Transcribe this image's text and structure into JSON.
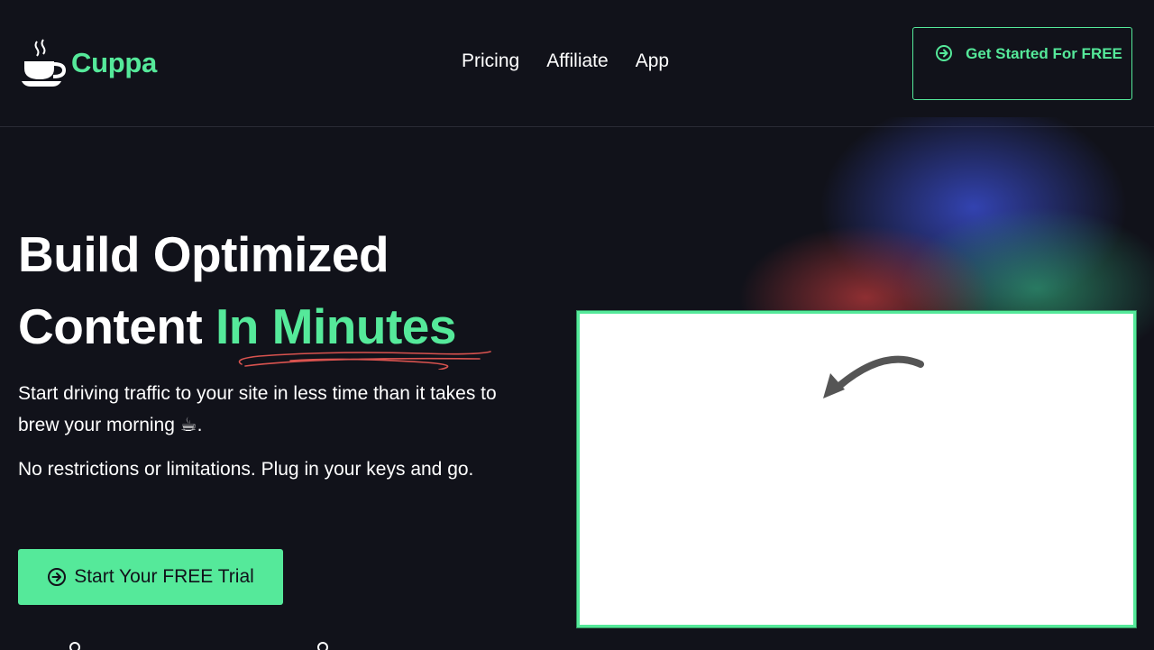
{
  "brand": {
    "name": "Cuppa",
    "accent_color": "#55e99a",
    "background_color": "#11121a",
    "logo_icon": "coffee-cup-icon"
  },
  "nav": {
    "items": [
      {
        "label": "Pricing"
      },
      {
        "label": "Affiliate"
      },
      {
        "label": "App"
      }
    ]
  },
  "header_cta": {
    "label": "Get Started For FREE",
    "icon": "arrow-right-circle-icon"
  },
  "hero": {
    "title_part1": "Build Optimized Content ",
    "title_accent": "In Minutes",
    "paragraph1": "Start driving traffic to your site in less time than it takes to brew your morning ☕.",
    "paragraph2": "No restrictions or limitations. Plug in your keys and go.",
    "cta_label": "Start Your FREE Trial",
    "cta_icon": "arrow-right-circle-icon"
  },
  "demo": {
    "arrow_icon": "curved-arrow-icon"
  }
}
